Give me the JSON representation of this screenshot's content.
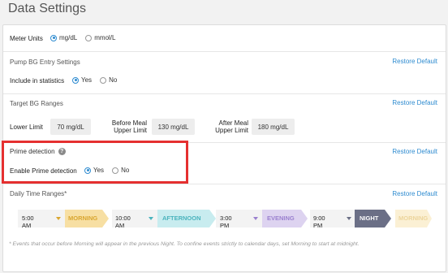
{
  "page": {
    "title": "Data Settings"
  },
  "meter_units": {
    "label": "Meter Units",
    "options": [
      {
        "label": "mg/dL",
        "selected": true
      },
      {
        "label": "mmol/L",
        "selected": false
      }
    ]
  },
  "pump_bg": {
    "heading": "Pump BG Entry Settings",
    "restore_label": "Restore Default",
    "include_label": "Include in statistics",
    "options": [
      {
        "label": "Yes",
        "selected": true
      },
      {
        "label": "No",
        "selected": false
      }
    ]
  },
  "target_bg": {
    "heading": "Target BG Ranges",
    "restore_label": "Restore Default",
    "lower_limit_label": "Lower Limit",
    "lower_limit_value": "70 mg/dL",
    "before_meal_label_1": "Before Meal",
    "before_meal_label_2": "Upper Limit",
    "before_meal_value": "130 mg/dL",
    "after_meal_label_1": "After Meal",
    "after_meal_label_2": "Upper Limit",
    "after_meal_value": "180 mg/dL"
  },
  "prime_detection": {
    "heading": "Prime detection",
    "help_icon": "question-circle-icon",
    "restore_label": "Restore Default",
    "enable_label": "Enable Prime detection",
    "options": [
      {
        "label": "Yes",
        "selected": true
      },
      {
        "label": "No",
        "selected": false
      }
    ]
  },
  "daily_ranges": {
    "heading": "Daily Time Ranges*",
    "restore_label": "Restore Default",
    "segments": [
      {
        "time": "5:00 AM",
        "label": "MORNING",
        "color": "#f7dfa3",
        "text_color": "#d9a630"
      },
      {
        "time": "10:00 AM",
        "label": "AFTERNOON",
        "color": "#c8ecef",
        "text_color": "#4ab3bd"
      },
      {
        "time": "3:00 PM",
        "label": "EVENING",
        "color": "#ddd3f0",
        "text_color": "#9a80cf"
      },
      {
        "time": "9:00 PM",
        "label": "NIGHT",
        "color": "#6b6f86",
        "text_color": "#ffffff"
      }
    ],
    "trailing_label": "MORNING",
    "footnote": "* Events that occur before Morning will appear in the previous Night. To confine events strictly to calendar days, set Morning to start at midnight."
  },
  "colors": {
    "accent": "#2e8bd0",
    "highlight": "#e53030"
  }
}
